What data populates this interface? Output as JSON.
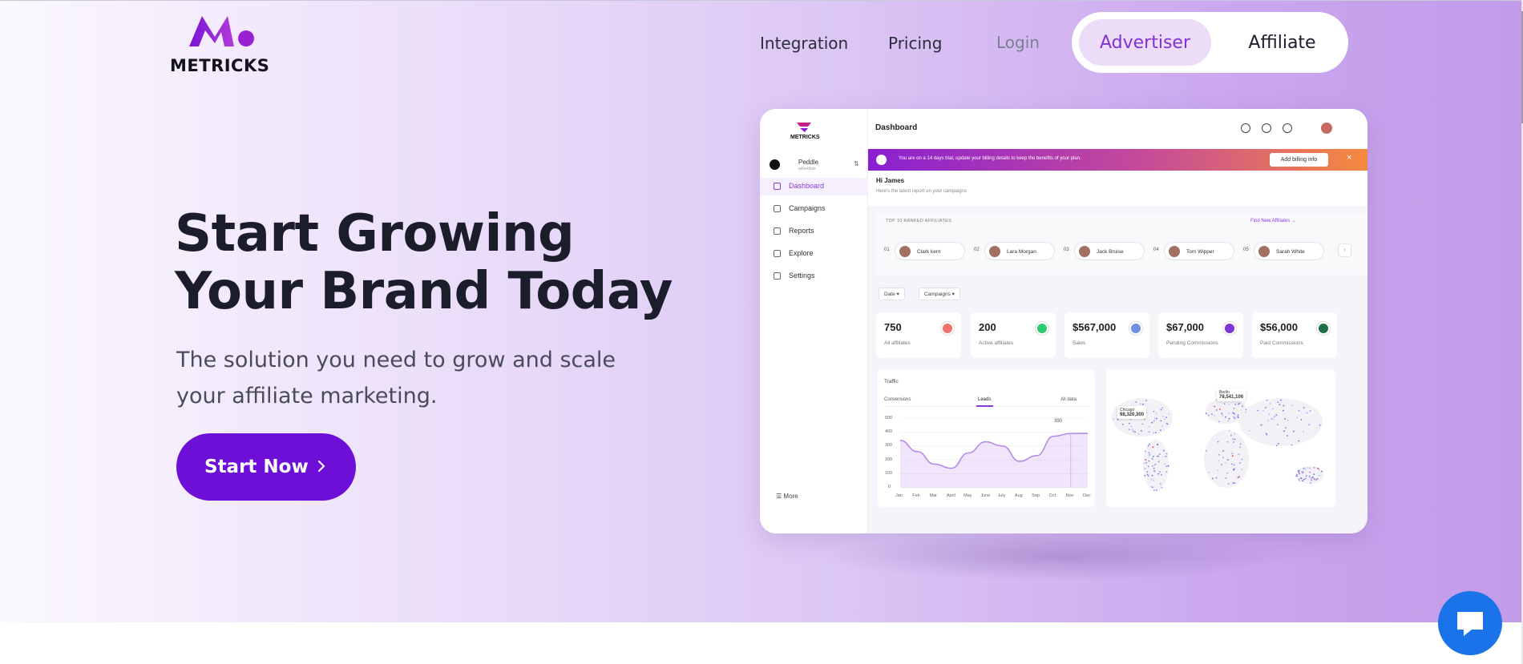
{
  "brand": {
    "name": "METRICKS",
    "accent": "#6d0fd6"
  },
  "nav": {
    "integration": "Integration",
    "pricing": "Pricing",
    "login": "Login",
    "roles": {
      "advertiser": "Advertiser",
      "affiliate": "Affiliate",
      "selected": "Advertiser"
    }
  },
  "hero": {
    "headline_line1": "Start Growing",
    "headline_line2": "Your Brand Today",
    "subhead_line1": "The solution you need to grow and scale",
    "subhead_line2": "your affiliate marketing.",
    "cta_label": "Start Now"
  },
  "dashboard": {
    "logo": "METRICKS",
    "title": "Dashboard",
    "user": {
      "name": "Peddle",
      "role": "advertiser"
    },
    "menu": [
      "Dashboard",
      "Campaigns",
      "Reports",
      "Explore",
      "Settings"
    ],
    "menu_active": "Dashboard",
    "more": "More",
    "banner": {
      "text": "You are on a 14 days trial, update your billing details to keep the benefits of your plan.",
      "button": "Add billing info",
      "close": "×"
    },
    "greeting": "Hi James",
    "greeting_sub": "Here's the latest report on your campaigns",
    "ranked_title": "TOP 10 RANKED AFFILIATES",
    "find_link": "Find New Affiliates →",
    "affiliates": [
      {
        "rank": "01",
        "name": "Clark kent"
      },
      {
        "rank": "02",
        "name": "Lara Morgan"
      },
      {
        "rank": "03",
        "name": "Jack Bruise"
      },
      {
        "rank": "04",
        "name": "Tom Wipper"
      },
      {
        "rank": "05",
        "name": "Sarah White"
      }
    ],
    "filters": {
      "date": "Date ▾",
      "campaigns": "Campaigns ▾"
    },
    "stats": [
      {
        "value": "750",
        "label": "All affiliates",
        "color": "#f0736b"
      },
      {
        "value": "200",
        "label": "Active affiliates",
        "color": "#2ecc71"
      },
      {
        "value": "$567,000",
        "label": "Sales",
        "color": "#6f8fe0"
      },
      {
        "value": "$67,000",
        "label": "Pending Commissions",
        "color": "#7b35d9"
      },
      {
        "value": "$56,000",
        "label": "Paid Commissions",
        "color": "#1e6e46"
      }
    ],
    "traffic": {
      "title": "Traffic",
      "tabs": [
        "Conversions",
        "Leads",
        "All data"
      ],
      "active_tab": "Leads",
      "peak_label": "390",
      "y_ticks": [
        "500",
        "400",
        "300",
        "200",
        "100",
        "0"
      ],
      "months": [
        "Jan",
        "Feb",
        "Mar",
        "April",
        "May",
        "June",
        "July",
        "Aug",
        "Sep",
        "Oct",
        "Nov",
        "Dec"
      ],
      "values": [
        340,
        260,
        170,
        140,
        250,
        330,
        300,
        190,
        230,
        370,
        390,
        390
      ],
      "ylim": [
        0,
        500
      ]
    },
    "map": {
      "labels": [
        {
          "city": "Chicago",
          "value": "98,320,300"
        },
        {
          "city": "Berlin",
          "value": "78,541,106"
        }
      ]
    }
  }
}
